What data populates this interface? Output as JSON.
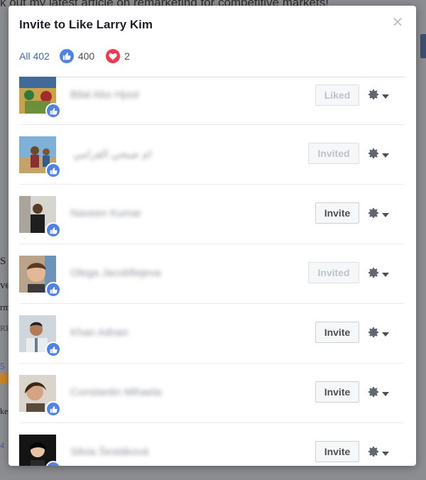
{
  "background": {
    "top_text": "k out my latest article on remarketing for competitive markets!",
    "left_fragments": [
      "S",
      "ve",
      "rm",
      "RE",
      "5",
      "ke",
      "4"
    ]
  },
  "dialog": {
    "title": "Invite to Like Larry Kim",
    "close_icon": "close-icon",
    "tabs": {
      "all_label": "All 402",
      "like_count": "400",
      "love_count": "2"
    },
    "rows": [
      {
        "name": "Bilal Abo Hjool",
        "action": "Liked",
        "state": "disabled"
      },
      {
        "name": "ام صبحي القرامي",
        "action": "Invited",
        "state": "disabled"
      },
      {
        "name": "Naveen Kumar",
        "action": "Invite",
        "state": "enabled"
      },
      {
        "name": "Olega Jacobfiejeva",
        "action": "Invited",
        "state": "disabled"
      },
      {
        "name": "Khan Adnan",
        "action": "Invite",
        "state": "enabled"
      },
      {
        "name": "Constantin Mihaela",
        "action": "Invite",
        "state": "enabled"
      },
      {
        "name": "Silvia Šestáková",
        "action": "Invite",
        "state": "enabled"
      }
    ]
  },
  "colors": {
    "link_blue": "#4267b2",
    "like_blue": "#4f82e8",
    "love_red": "#f0384f"
  }
}
